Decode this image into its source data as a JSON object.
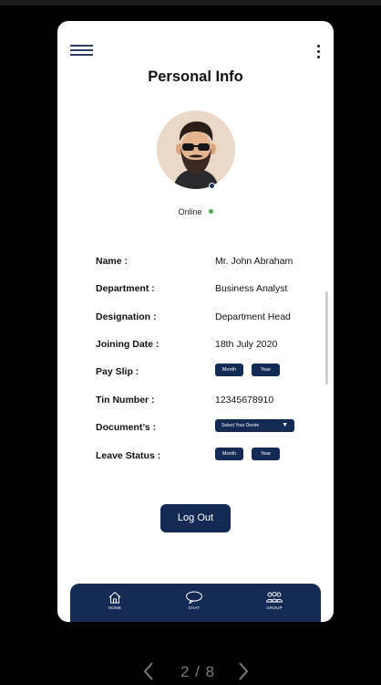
{
  "screen": {
    "title": "Personal Info",
    "status": "Online"
  },
  "profile": {
    "rows": [
      {
        "label": "Name :",
        "value": "Mr. John Abraham"
      },
      {
        "label": "Department :",
        "value": "Business Analyst"
      },
      {
        "label": "Designation :",
        "value": "Department Head"
      },
      {
        "label": "Joining Date :",
        "value": "18th July 2020"
      },
      {
        "label": "Pay Slip :",
        "month": "Month",
        "year": "Year"
      },
      {
        "label": "Tin Number :",
        "value": "12345678910"
      },
      {
        "label": "Document’s :",
        "select": "Select Your Desire"
      },
      {
        "label": "Leave Status :",
        "month": "Month",
        "year": "Year"
      }
    ]
  },
  "actions": {
    "logout": "Log Out"
  },
  "nav": {
    "home": "HOME",
    "chat": "CHAT",
    "group": "GROUP"
  },
  "pager": {
    "text": "2 / 8"
  },
  "colors": {
    "primary": "#132a54",
    "online": "#4caf50",
    "avatar_bg": "#ead9c7"
  },
  "icons": [
    "menu-icon",
    "more-vertical-icon",
    "home-icon",
    "chat-icon",
    "group-icon",
    "chevron-left-icon",
    "chevron-right-icon",
    "chevron-down-icon"
  ]
}
